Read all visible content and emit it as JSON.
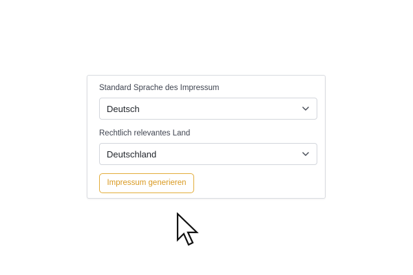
{
  "form": {
    "language_label": "Standard Sprache des Impressum",
    "language_value": "Deutsch",
    "country_label": "Rechtlich relevantes Land",
    "country_value": "Deutschland",
    "generate_button_label": "Impressum generieren"
  },
  "icons": {
    "select_chevron": "chevron-down-icon",
    "pointer": "mouse-pointer-icon"
  },
  "colors": {
    "accent": "#e3ad3b",
    "accent_text": "#d99a22",
    "border": "#d3d6dc",
    "text": "#1f2329",
    "label_text": "#3f4450"
  }
}
